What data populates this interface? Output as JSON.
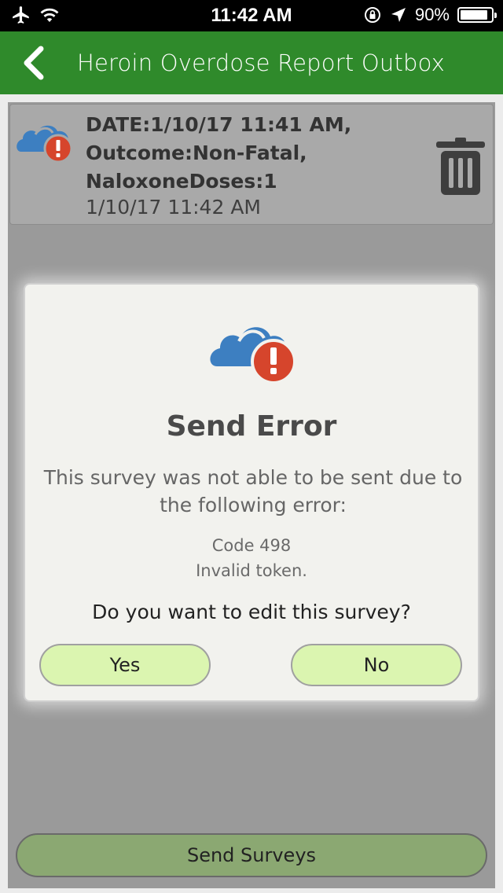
{
  "status_bar": {
    "time": "11:42 AM",
    "battery_percent": "90%",
    "battery_level": 0.9
  },
  "header": {
    "title": "Heroin Overdose Report Outbox",
    "back_icon": "chevron-left-icon"
  },
  "outbox": {
    "items": [
      {
        "summary": "DATE:1/10/17 11:41 AM,\nOutcome:Non-Fatal,\nNaloxoneDoses:1",
        "timestamp": "1/10/17 11:42 AM",
        "icon": "cloud-error-icon"
      }
    ]
  },
  "dialog": {
    "title": "Send Error",
    "message": "This survey was not able to be sent due to the following error:",
    "code": "Code 498",
    "detail": "Invalid token.",
    "question": "Do you want to edit this survey?",
    "yes_label": "Yes",
    "no_label": "No"
  },
  "footer": {
    "send_label": "Send Surveys"
  },
  "colors": {
    "header_bg": "#2f8a2b",
    "cloud_blue": "#3d7fc1",
    "error_red": "#d6452c",
    "button_green": "#dbf5b0",
    "send_button": "#8ba872"
  }
}
